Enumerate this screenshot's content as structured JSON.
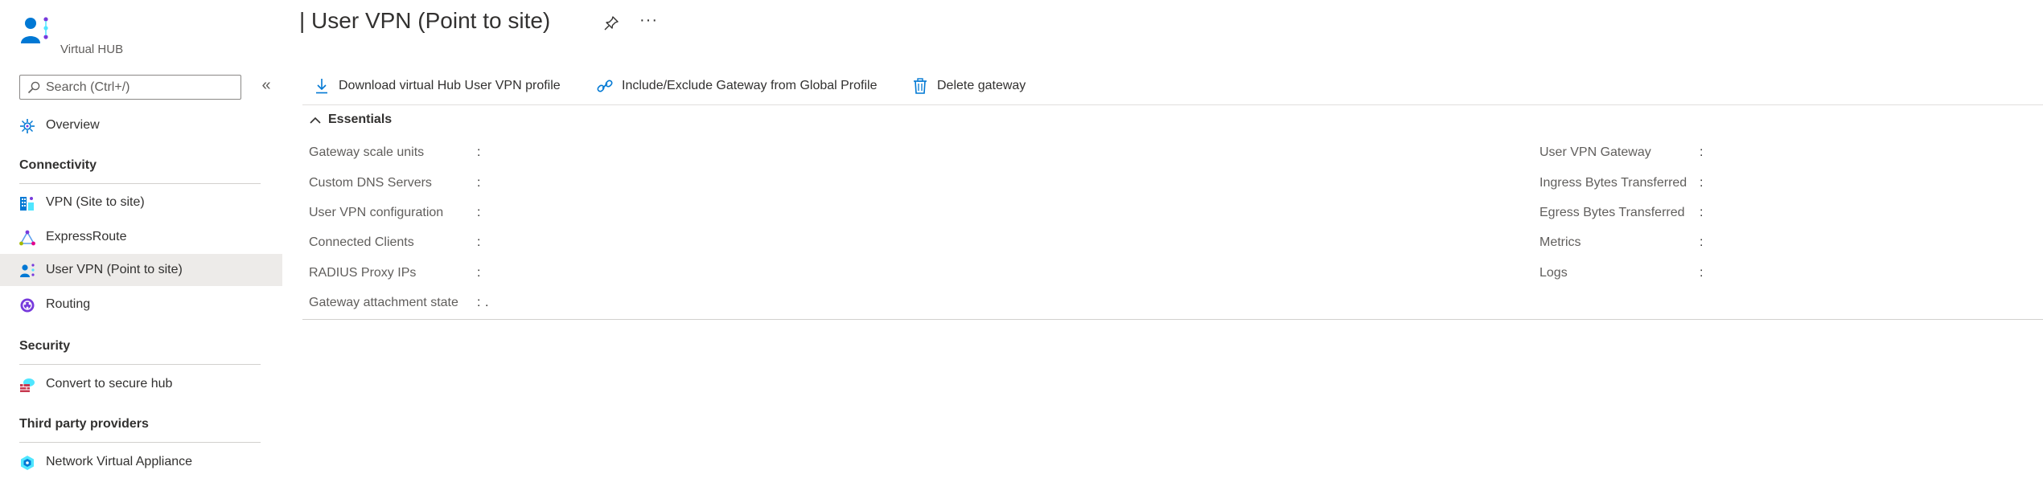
{
  "colors": {
    "accent": "#0078d4",
    "active_bg": "#edebe9",
    "text": "#323130",
    "muted": "#605e5c"
  },
  "sidebar": {
    "brand_subtitle": "Virtual HUB",
    "brand_icon": "user-vpn-icon",
    "search": {
      "placeholder": "Search (Ctrl+/)",
      "value": ""
    },
    "collapse_label": "«",
    "overview": {
      "label": "Overview",
      "icon": "overview-icon"
    },
    "sections": [
      {
        "label": "Connectivity",
        "items": [
          {
            "label": "VPN (Site to site)",
            "icon": "vpn-site-icon"
          },
          {
            "label": "ExpressRoute",
            "icon": "expressroute-icon"
          },
          {
            "label": "User VPN (Point to site)",
            "icon": "user-vpn-icon",
            "active": true
          },
          {
            "label": "Routing",
            "icon": "routing-icon"
          }
        ]
      },
      {
        "label": "Security",
        "items": [
          {
            "label": "Convert to secure hub",
            "icon": "secure-hub-icon"
          }
        ]
      },
      {
        "label": "Third party providers",
        "items": [
          {
            "label": "Network Virtual Appliance",
            "icon": "nva-icon"
          }
        ]
      }
    ]
  },
  "header": {
    "title": "| User VPN (Point to site)",
    "pin_icon": "pin-icon",
    "more_label": "···"
  },
  "commands": {
    "download": {
      "label": "Download virtual Hub User VPN profile",
      "icon": "download-icon"
    },
    "include_exclude": {
      "label": "Include/Exclude Gateway from Global Profile",
      "icon": "link-icon"
    },
    "delete": {
      "label": "Delete gateway",
      "icon": "delete-icon"
    }
  },
  "essentials": {
    "label": "Essentials",
    "left": [
      {
        "key": "Gateway scale units",
        "value": ""
      },
      {
        "key": "Custom DNS Servers",
        "value": ""
      },
      {
        "key": "User VPN configuration",
        "value": ""
      },
      {
        "key": "Connected Clients",
        "value": ""
      },
      {
        "key": "RADIUS Proxy IPs",
        "value": ""
      },
      {
        "key": "Gateway attachment state",
        "value": "."
      }
    ],
    "right": [
      {
        "key": "User VPN Gateway",
        "value": ""
      },
      {
        "key": "Ingress Bytes Transferred",
        "value": ""
      },
      {
        "key": "Egress Bytes Transferred",
        "value": ""
      },
      {
        "key": "Metrics",
        "value": ""
      },
      {
        "key": "Logs",
        "value": ""
      }
    ],
    "separator": ":"
  }
}
